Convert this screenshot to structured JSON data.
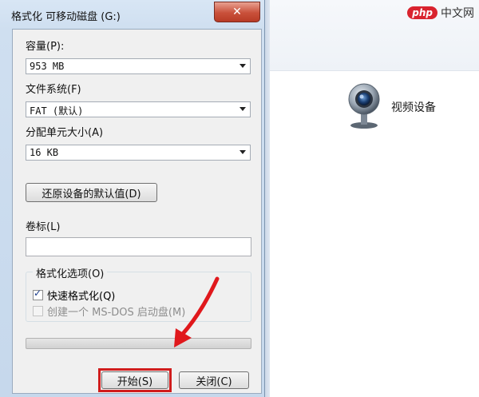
{
  "watermark": {
    "badge": "php",
    "text": "中文网"
  },
  "explorer": {
    "device_label": "视频设备",
    "device_icon": "webcam-icon"
  },
  "dialog": {
    "title": "格式化 可移动磁盘 (G:)",
    "close_glyph": "✕",
    "capacity": {
      "label": "容量(P):",
      "value": "953 MB"
    },
    "filesystem": {
      "label": "文件系统(F)",
      "value": "FAT (默认)"
    },
    "allocation": {
      "label": "分配单元大小(A)",
      "value": "16 KB"
    },
    "restore_defaults": "还原设备的默认值(D)",
    "volume_label": {
      "label": "卷标(L)",
      "value": ""
    },
    "options": {
      "legend": "格式化选项(O)",
      "quick_format": {
        "label": "快速格式化(Q)",
        "checked": true
      },
      "msdos_disk": {
        "label": "创建一个 MS-DOS 启动盘(M)",
        "checked": false,
        "enabled": false
      }
    },
    "progress": 0,
    "start_button": "开始(S)",
    "close_button": "关闭(C)"
  },
  "colors": {
    "dialog_frame": "#cfdff0",
    "client_bg": "#f0f0f0",
    "close_red": "#c9503a",
    "highlight_red": "#d01c1c",
    "watermark_red": "#d9232e"
  }
}
